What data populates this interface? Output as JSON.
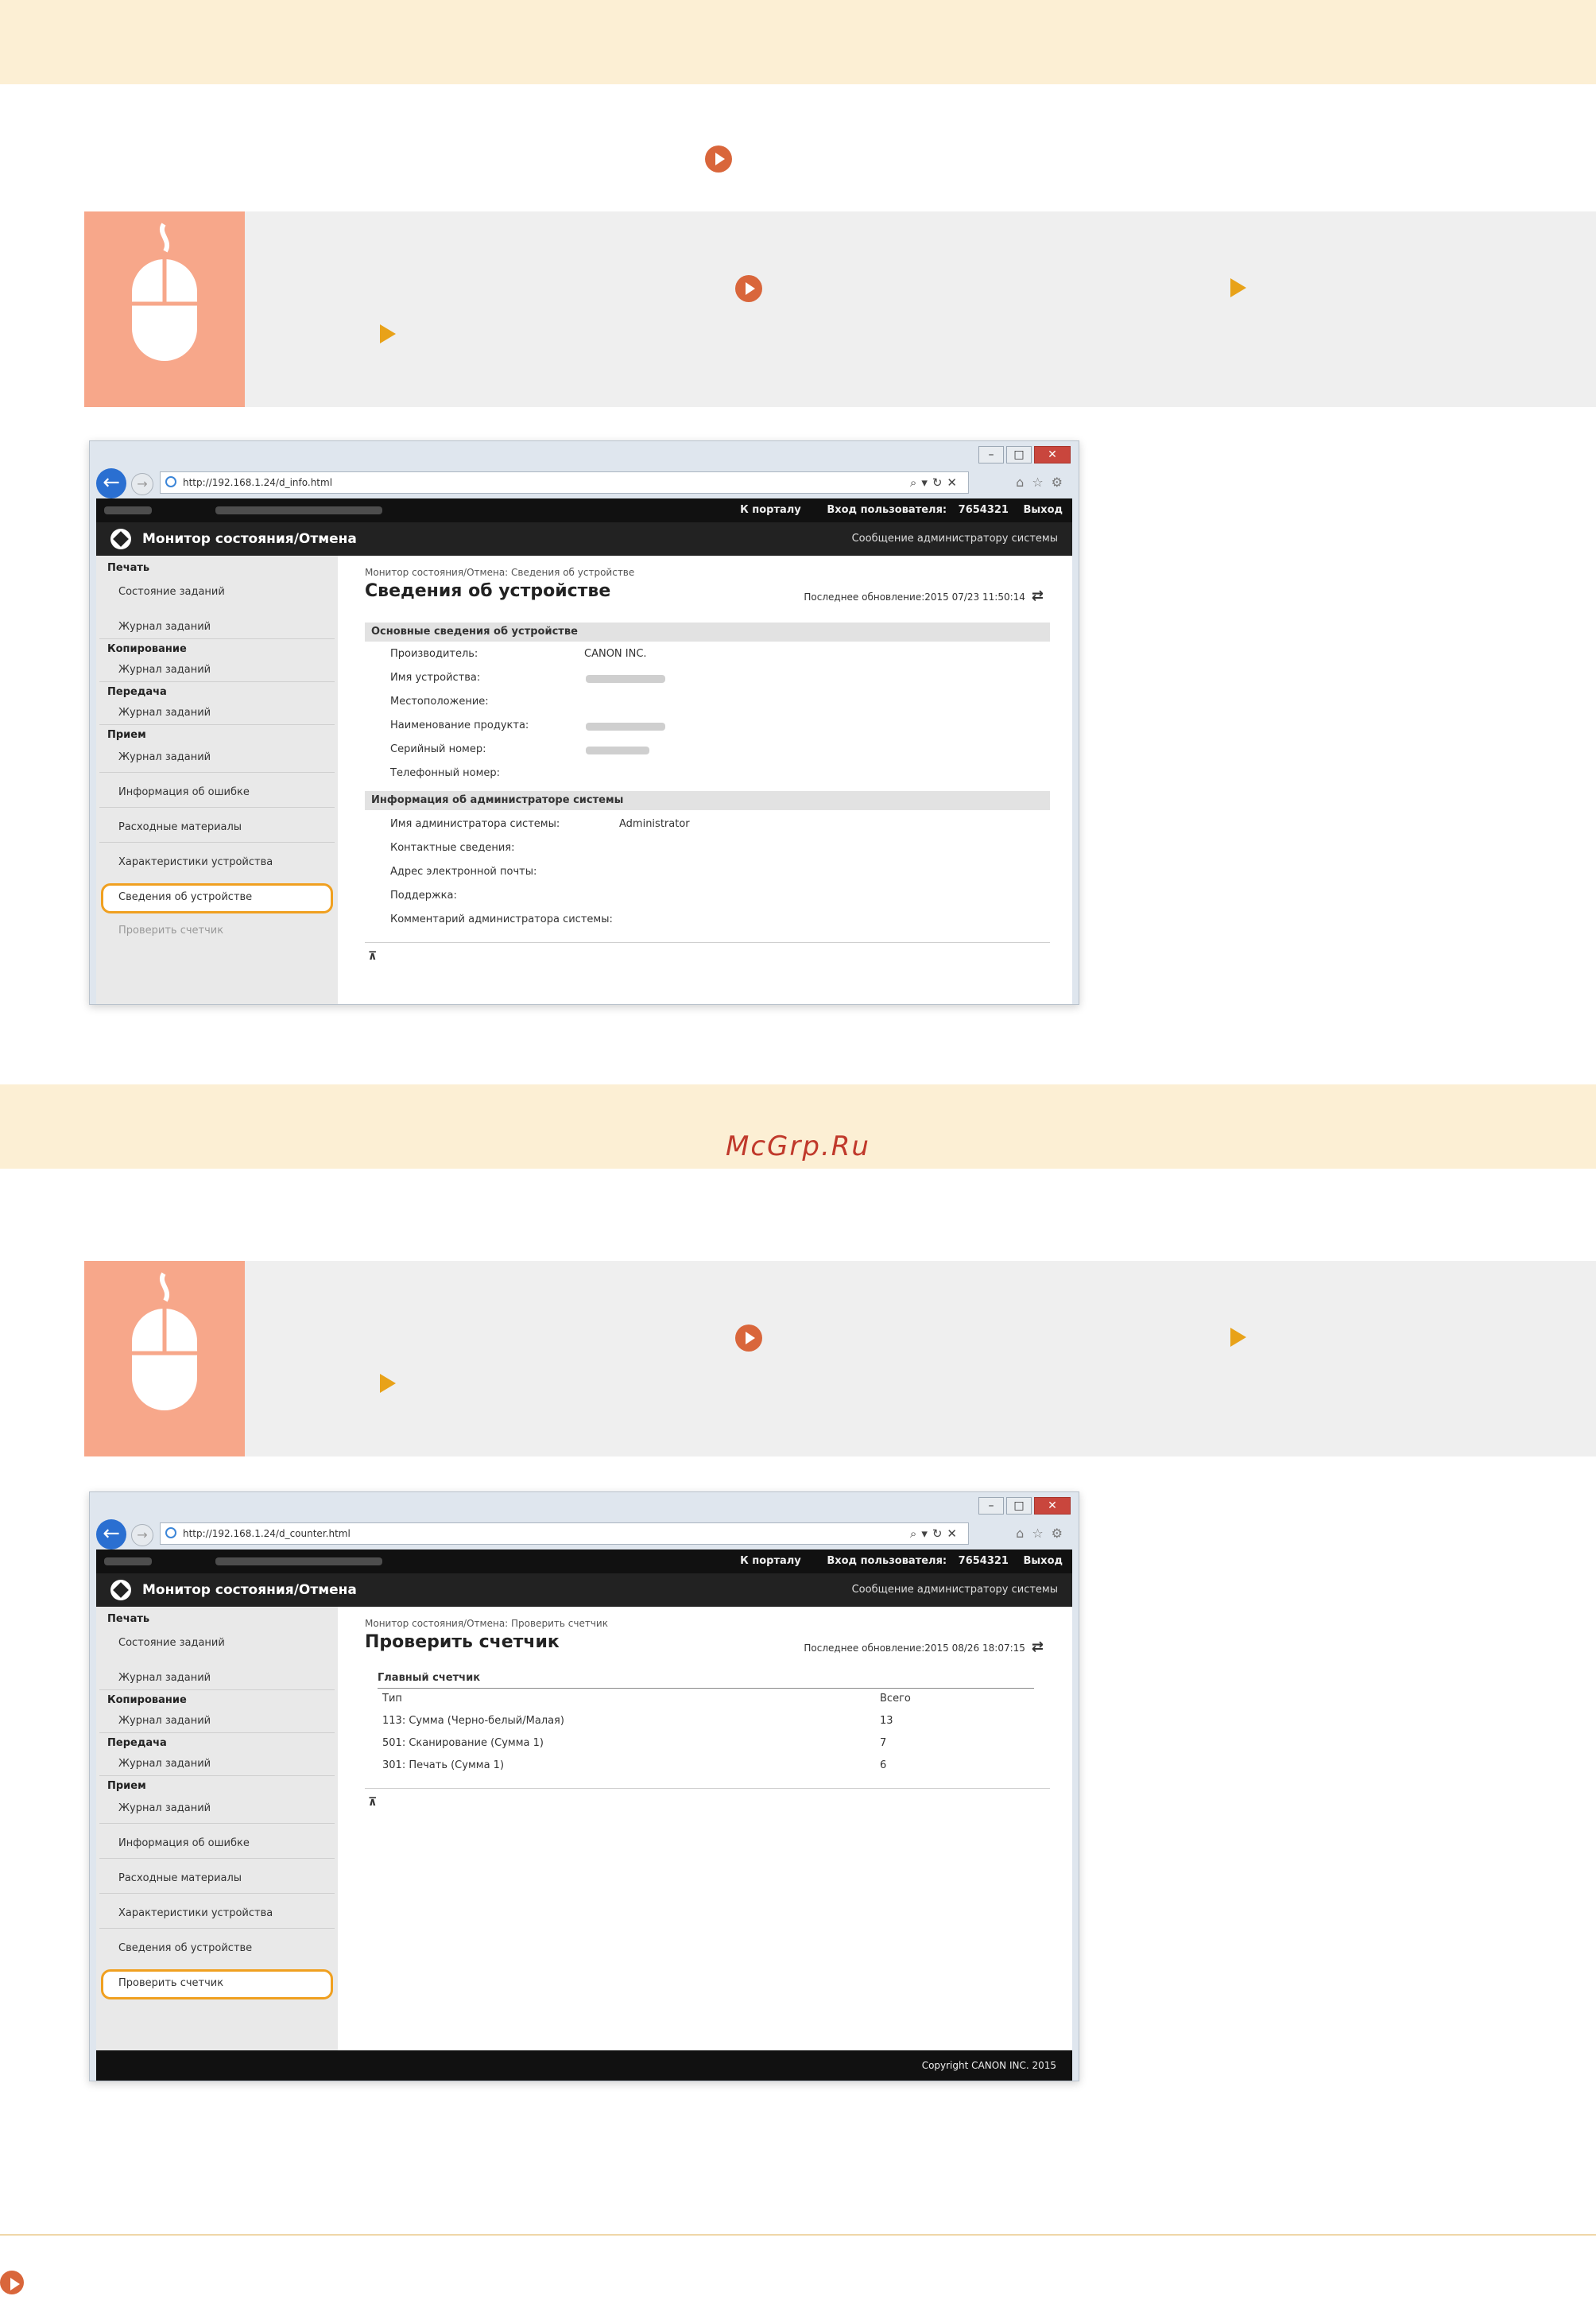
{
  "watermark": "McGrp.Ru",
  "window1": {
    "url": "http://192.168.1.24/d_info.html",
    "topbar": {
      "portal_link": "К порталу",
      "login_label": "Вход пользователя:",
      "login_value": "7654321",
      "logout": "Выход"
    },
    "app_title": "Монитор состояния/Отмена",
    "admin_msg": "Сообщение администратору системы",
    "sidebar": {
      "print_head": "Печать",
      "print_status": "Состояние заданий",
      "print_log": "Журнал заданий",
      "copy_head": "Копирование",
      "copy_log": "Журнал заданий",
      "send_head": "Передача",
      "send_log": "Журнал заданий",
      "recv_head": "Прием",
      "recv_log": "Журнал заданий",
      "error_info": "Информация об ошибке",
      "consumables": "Расходные материалы",
      "device_features": "Характеристики устройства",
      "device_info": "Сведения об устройстве",
      "check_counter": "Проверить счетчик"
    },
    "breadcrumb": "Монитор состояния/Отмена: Сведения об устройстве",
    "page_title": "Сведения об устройстве",
    "last_update": "Последнее обновление:2015 07/23 11:50:14",
    "section1": "Основные сведения об устройстве",
    "fields1": {
      "manufacturer": "Производитель:",
      "manufacturer_value": "CANON INC.",
      "device_name": "Имя устройства:",
      "location": "Местоположение:",
      "product_name": "Наименование продукта:",
      "serial": "Серийный номер:",
      "phone": "Телефонный номер:"
    },
    "section2": "Информация об администраторе системы",
    "fields2": {
      "admin_name": "Имя администратора системы:",
      "admin_name_value": "Administrator",
      "contact": "Контактные сведения:",
      "email": "Адрес электронной почты:",
      "support": "Поддержка:",
      "comment": "Комментарий администратора системы:"
    }
  },
  "window2": {
    "url": "http://192.168.1.24/d_counter.html",
    "topbar": {
      "portal_link": "К порталу",
      "login_label": "Вход пользователя:",
      "login_value": "7654321",
      "logout": "Выход"
    },
    "app_title": "Монитор состояния/Отмена",
    "admin_msg": "Сообщение администратору системы",
    "sidebar": {
      "print_head": "Печать",
      "print_status": "Состояние заданий",
      "print_log": "Журнал заданий",
      "copy_head": "Копирование",
      "copy_log": "Журнал заданий",
      "send_head": "Передача",
      "send_log": "Журнал заданий",
      "recv_head": "Прием",
      "recv_log": "Журнал заданий",
      "error_info": "Информация об ошибке",
      "consumables": "Расходные материалы",
      "device_features": "Характеристики устройства",
      "device_info": "Сведения об устройстве",
      "check_counter": "Проверить счетчик"
    },
    "breadcrumb": "Монитор состояния/Отмена: Проверить счетчик",
    "page_title": "Проверить счетчик",
    "last_update": "Последнее обновление:2015 08/26 18:07:15",
    "counter_head": "Главный счетчик",
    "col_type": "Тип",
    "col_total": "Всего",
    "rows": [
      {
        "type": "113: Сумма (Черно-белый/Малая)",
        "total": "13"
      },
      {
        "type": "501: Сканирование (Сумма 1)",
        "total": "7"
      },
      {
        "type": "301: Печать (Сумма 1)",
        "total": "6"
      }
    ],
    "footer": "Copyright CANON INC. 2015"
  }
}
